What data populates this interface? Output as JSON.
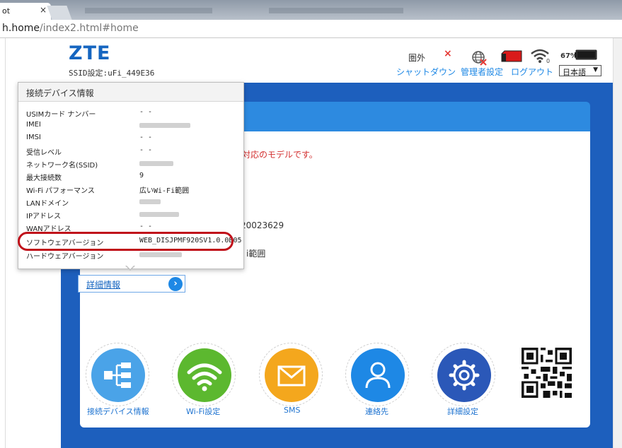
{
  "browser": {
    "tab_title": "ot",
    "tab_close": "×",
    "url_host": "h.home",
    "url_path": "/index2.html#home"
  },
  "header": {
    "logo": "ZTE",
    "ssid": "SSID設定:uFi_449E36",
    "signal_status": "圏外",
    "battery_percent": "67%",
    "links": [
      "シャットダウン",
      "管理者設定",
      "ログアウト"
    ],
    "language": "日本語"
  },
  "colors": {
    "brand_blue": "#1565c0",
    "band_blue": "#1d5fbd",
    "highlight_red": "#c0101a",
    "icon_device": "#4aa3e8",
    "icon_wifi": "#5cb82f",
    "icon_sms": "#f4a71d",
    "icon_contacts": "#1e88e5",
    "icon_settings": "#2b58b8"
  },
  "popup": {
    "title": "接続デバイス情報",
    "rows": [
      {
        "label": "USIMカード ナンバー",
        "value": "- -"
      },
      {
        "label": "IMEI",
        "value": ""
      },
      {
        "label": "IMSI",
        "value": "- -"
      },
      {
        "label": "受信レベル",
        "value": "- -"
      },
      {
        "label": "ネットワーク名(SSID)",
        "value": ""
      },
      {
        "label": "最大接続数",
        "value": "9"
      },
      {
        "label": "Wi-Fi パフォーマンス",
        "value": "広いWi-Fi範囲"
      },
      {
        "label": "LANドメイン",
        "value": ""
      },
      {
        "label": "IPアドレス",
        "value": ""
      },
      {
        "label": "WANアドレス",
        "value": "- -"
      },
      {
        "label": "ソフトウェアバージョン",
        "value": "WEB_DISJPMF920SV1.0.0B05"
      },
      {
        "label": "ハードウェアバージョン",
        "value": ""
      }
    ]
  },
  "content": {
    "notice_fragment": "対応のモデルです。",
    "fragment_number": "20023629",
    "fragment_wifi": "i範囲",
    "detail_link": "詳細情報"
  },
  "shortcuts": [
    {
      "label": "接続デバイス情報",
      "icon": "device-tree-icon"
    },
    {
      "label": "Wi-Fi設定",
      "icon": "wifi-icon"
    },
    {
      "label": "SMS",
      "icon": "envelope-icon"
    },
    {
      "label": "連絡先",
      "icon": "person-icon"
    },
    {
      "label": "詳細設定",
      "icon": "gear-icon"
    }
  ]
}
